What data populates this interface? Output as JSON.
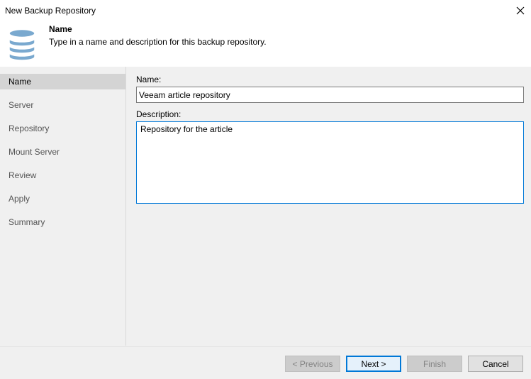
{
  "window": {
    "title": "New Backup Repository"
  },
  "header": {
    "title": "Name",
    "description": "Type in a name and description for this backup repository."
  },
  "sidebar": {
    "items": [
      {
        "label": "Name"
      },
      {
        "label": "Server"
      },
      {
        "label": "Repository"
      },
      {
        "label": "Mount Server"
      },
      {
        "label": "Review"
      },
      {
        "label": "Apply"
      },
      {
        "label": "Summary"
      }
    ]
  },
  "form": {
    "name_label": "Name:",
    "name_value": "Veeam article repository",
    "description_label": "Description:",
    "description_value": "Repository for the article"
  },
  "footer": {
    "previous": "< Previous",
    "next": "Next >",
    "finish": "Finish",
    "cancel": "Cancel"
  },
  "colors": {
    "accent": "#0078d7",
    "db_icon": "#7aa9cf"
  }
}
